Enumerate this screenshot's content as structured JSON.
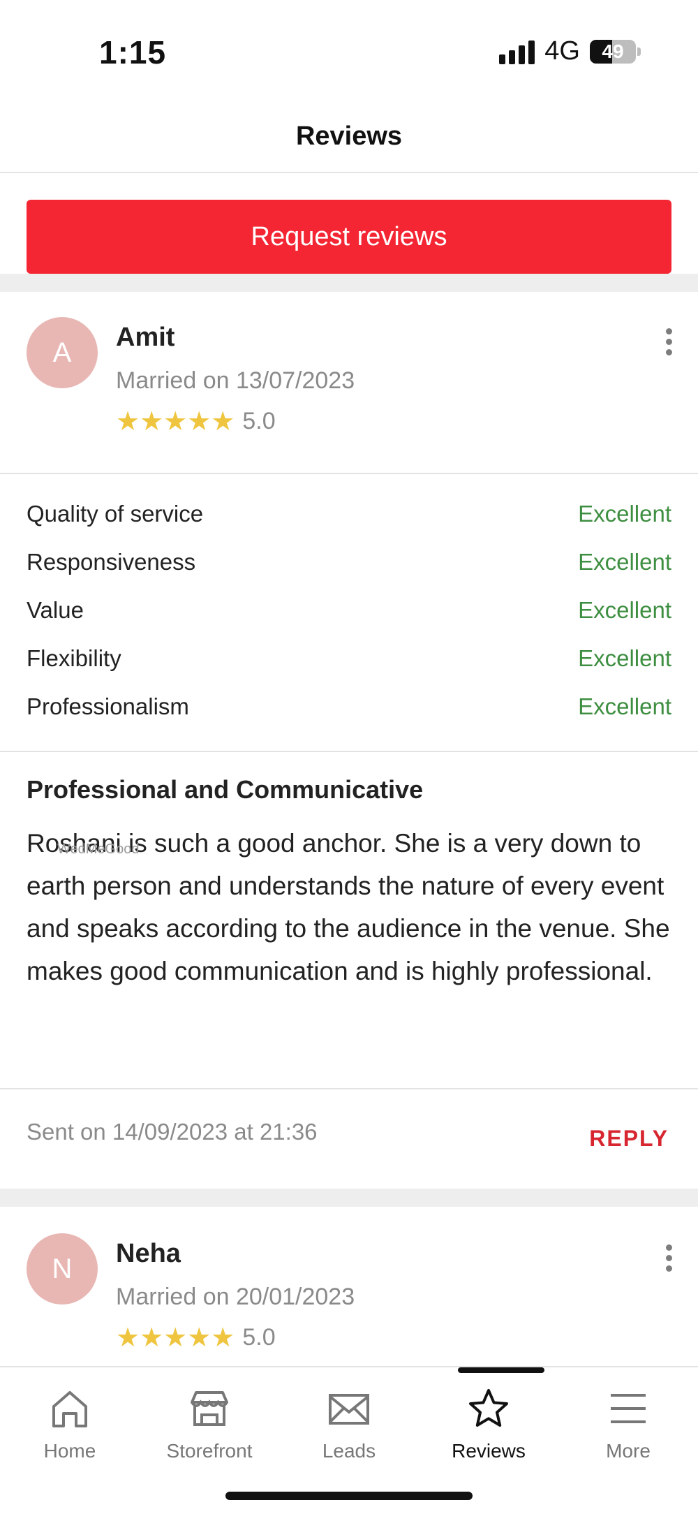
{
  "status_bar": {
    "time": "1:15",
    "network": "4G",
    "battery": "49",
    "battery_level": 0.49
  },
  "header": {
    "title": "Reviews"
  },
  "request_button": {
    "label": "Request reviews"
  },
  "reviews": [
    {
      "avatar_initial": "A",
      "name": "Amit",
      "married": "Married on 13/07/2023",
      "stars": "★★★★★",
      "rating": "5.0",
      "criteria": [
        {
          "label": "Quality of service",
          "value": "Excellent"
        },
        {
          "label": "Responsiveness",
          "value": "Excellent"
        },
        {
          "label": "Value",
          "value": "Excellent"
        },
        {
          "label": "Flexibility",
          "value": "Excellent"
        },
        {
          "label": "Professionalism",
          "value": "Excellent"
        }
      ],
      "title": "Professional and Communicative",
      "body": "Roshani is such a good anchor. She is a very down to earth person and understands the nature of every event and speaks according to the audience in the venue. She makes good communication and is highly professional.",
      "watermark": "WedMeGood",
      "sent": "Sent on 14/09/2023 at 21:36",
      "reply_label": "REPLY"
    },
    {
      "avatar_initial": "N",
      "name": "Neha",
      "married": "Married on 20/01/2023",
      "stars": "★★★★★",
      "rating": "5.0"
    }
  ],
  "nav": {
    "items": [
      {
        "label": "Home",
        "icon": "home-icon"
      },
      {
        "label": "Storefront",
        "icon": "storefront-icon"
      },
      {
        "label": "Leads",
        "icon": "mail-icon"
      },
      {
        "label": "Reviews",
        "icon": "star-icon",
        "active": true
      },
      {
        "label": "More",
        "icon": "menu-icon"
      }
    ]
  },
  "colors": {
    "accent": "#f42634",
    "excellent": "#3e8e41",
    "star": "#efc53f",
    "avatar": "#e8b7b3",
    "reply": "#d7262f"
  }
}
